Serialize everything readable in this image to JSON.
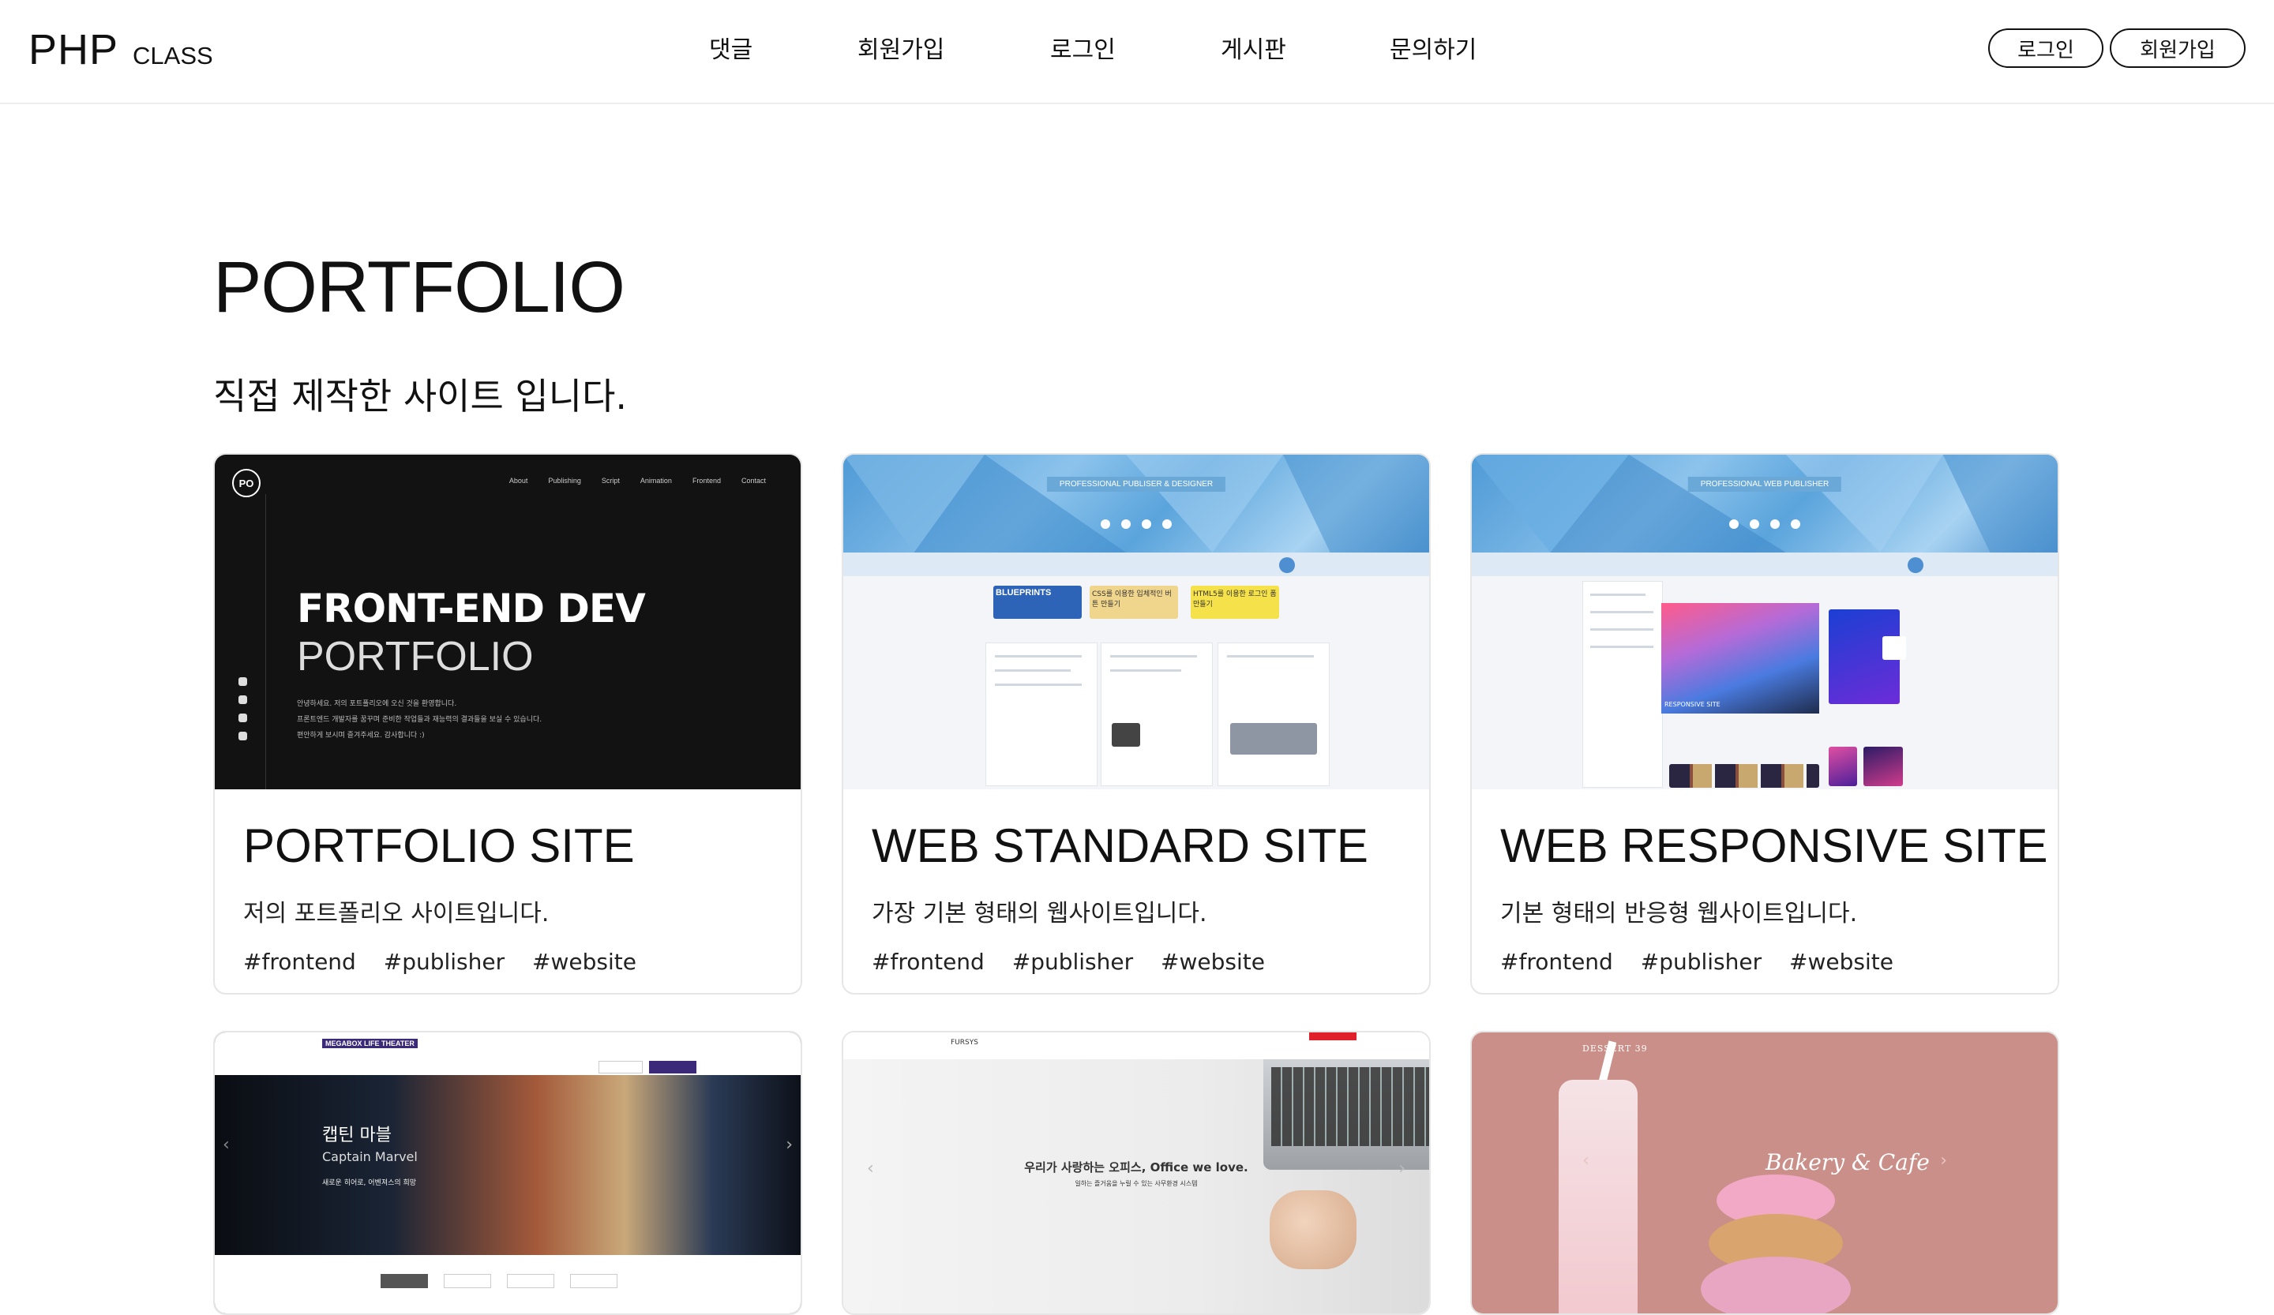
{
  "header": {
    "logo_main": "PHP",
    "logo_sub": "CLASS",
    "nav": [
      "댓글",
      "회원가입",
      "로그인",
      "게시판",
      "문의하기"
    ],
    "login_button": "로그인",
    "join_button": "회원가입"
  },
  "section": {
    "title": "PORTFOLIO",
    "subtitle": "직접 제작한 사이트 입니다."
  },
  "cards": [
    {
      "title": "PORTFOLIO SITE",
      "desc": "저의 포트폴리오 사이트입니다.",
      "tags": [
        "#frontend",
        "#publisher",
        "#website"
      ],
      "thumb": {
        "badge": "PO",
        "menu": [
          "About",
          "Publishing",
          "Script",
          "Animation",
          "Frontend",
          "Contact"
        ],
        "heading1": "FRONT-END DEV",
        "heading2": "PORTFOLIO",
        "lines": [
          "안녕하세요. 저의 포트폴리오에 오신 것을 환영합니다.",
          "프론트엔드 개발자를 꿈꾸며 준비한 작업들과 재능력의 결과들을 보실 수 있습니다.",
          "편안하게 보시며 즐겨주세요. 감사합니다 :)"
        ]
      }
    },
    {
      "title": "WEB STANDARD SITE",
      "desc": "가장 기본 형태의 웹사이트입니다.",
      "tags": [
        "#frontend",
        "#publisher",
        "#website"
      ],
      "thumb": {
        "ribbon": "PROFESSIONAL PUBLISER & DESIGNER",
        "banners": [
          "BLUEPRINTS",
          "CSS를 이용한 입체적인 버튼 만들기",
          "HTML5를 이용한 로그인 폼 만들기"
        ]
      }
    },
    {
      "title": "WEB RESPONSIVE SITE",
      "desc": "기본 형태의 반응형 웹사이트입니다.",
      "tags": [
        "#frontend",
        "#publisher",
        "#website"
      ],
      "thumb": {
        "ribbon": "PROFESSIONAL WEB PUBLISHER",
        "feature": "RESPONSIVE SITE"
      }
    },
    {
      "thumb": {
        "brand": "MEGABOX LIFE THEATER",
        "movie_kr": "캡틴 마블",
        "movie_en": "Captain Marvel",
        "movie_sub": "새로운 히어로, 어벤져스의 희망"
      }
    },
    {
      "thumb": {
        "brand": "FURSYS",
        "headline": "우리가 사랑하는 오피스, Office we love.",
        "sub": "일하는 즐거움을 누릴 수 있는 사무환경 시스템"
      }
    },
    {
      "thumb": {
        "brand": "DESSERT 39",
        "script": "Bakery & Cafe"
      }
    }
  ]
}
